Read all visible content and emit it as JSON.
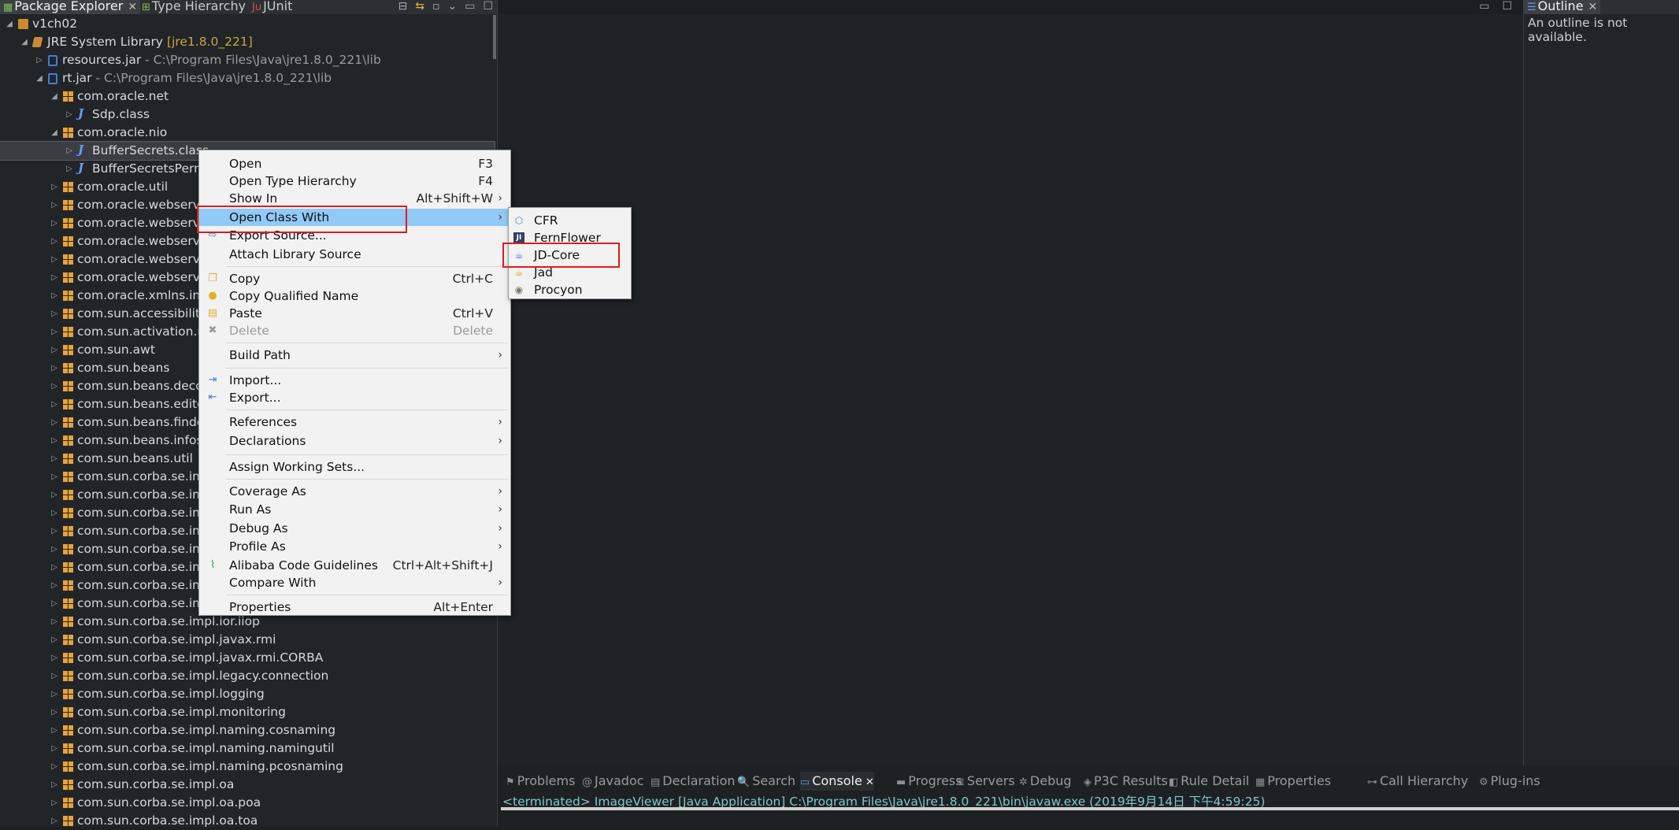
{
  "package_explorer": {
    "tabs": [
      {
        "label": "Package Explorer",
        "icon": "package-explorer-icon",
        "active": true
      },
      {
        "label": "Type Hierarchy",
        "icon": "type-hierarchy-icon",
        "active": false
      },
      {
        "label": "JUnit",
        "icon": "junit-icon",
        "active": false
      }
    ],
    "tree": [
      {
        "depth": 0,
        "twisty": "open",
        "icon": "project",
        "label": "v1ch02"
      },
      {
        "depth": 1,
        "twisty": "open",
        "icon": "lib",
        "label": "JRE System Library",
        "decor": "[jre1.8.0_221]"
      },
      {
        "depth": 2,
        "twisty": "closed",
        "icon": "jar",
        "label": "resources.jar",
        "decor": " - C:\\Program Files\\Java\\jre1.8.0_221\\lib"
      },
      {
        "depth": 2,
        "twisty": "open",
        "icon": "jar",
        "label": "rt.jar",
        "decor": " - C:\\Program Files\\Java\\jre1.8.0_221\\lib"
      },
      {
        "depth": 3,
        "twisty": "open",
        "icon": "pkg",
        "label": "com.oracle.net"
      },
      {
        "depth": 4,
        "twisty": "closed",
        "icon": "cls",
        "label": "Sdp.class"
      },
      {
        "depth": 3,
        "twisty": "open",
        "icon": "pkg",
        "label": "com.oracle.nio"
      },
      {
        "depth": 4,
        "twisty": "closed",
        "icon": "cls",
        "label": "BufferSecrets.class",
        "selected": true
      },
      {
        "depth": 4,
        "twisty": "closed",
        "icon": "cls",
        "label": "BufferSecretsPerm"
      },
      {
        "depth": 3,
        "twisty": "closed",
        "icon": "pkg",
        "label": "com.oracle.util"
      },
      {
        "depth": 3,
        "twisty": "closed",
        "icon": "pkg",
        "label": "com.oracle.webservi"
      },
      {
        "depth": 3,
        "twisty": "closed",
        "icon": "pkg",
        "label": "com.oracle.webservi"
      },
      {
        "depth": 3,
        "twisty": "closed",
        "icon": "pkg",
        "label": "com.oracle.webservi"
      },
      {
        "depth": 3,
        "twisty": "closed",
        "icon": "pkg",
        "label": "com.oracle.webservi"
      },
      {
        "depth": 3,
        "twisty": "closed",
        "icon": "pkg",
        "label": "com.oracle.webservi"
      },
      {
        "depth": 3,
        "twisty": "closed",
        "icon": "pkg",
        "label": "com.oracle.xmlns.int"
      },
      {
        "depth": 3,
        "twisty": "closed",
        "icon": "pkg",
        "label": "com.sun.accessibility"
      },
      {
        "depth": 3,
        "twisty": "closed",
        "icon": "pkg",
        "label": "com.sun.activation.re"
      },
      {
        "depth": 3,
        "twisty": "closed",
        "icon": "pkg",
        "label": "com.sun.awt"
      },
      {
        "depth": 3,
        "twisty": "closed",
        "icon": "pkg",
        "label": "com.sun.beans"
      },
      {
        "depth": 3,
        "twisty": "closed",
        "icon": "pkg",
        "label": "com.sun.beans.deco"
      },
      {
        "depth": 3,
        "twisty": "closed",
        "icon": "pkg",
        "label": "com.sun.beans.edito"
      },
      {
        "depth": 3,
        "twisty": "closed",
        "icon": "pkg",
        "label": "com.sun.beans.finde"
      },
      {
        "depth": 3,
        "twisty": "closed",
        "icon": "pkg",
        "label": "com.sun.beans.infos"
      },
      {
        "depth": 3,
        "twisty": "closed",
        "icon": "pkg",
        "label": "com.sun.beans.util"
      },
      {
        "depth": 3,
        "twisty": "closed",
        "icon": "pkg",
        "label": "com.sun.corba.se.impl"
      },
      {
        "depth": 3,
        "twisty": "closed",
        "icon": "pkg",
        "label": "com.sun.corba.se.imp"
      },
      {
        "depth": 3,
        "twisty": "closed",
        "icon": "pkg",
        "label": "com.sun.corba.se.imp"
      },
      {
        "depth": 3,
        "twisty": "closed",
        "icon": "pkg",
        "label": "com.sun.corba.se.im"
      },
      {
        "depth": 3,
        "twisty": "closed",
        "icon": "pkg",
        "label": "com.sun.corba.se.im"
      },
      {
        "depth": 3,
        "twisty": "closed",
        "icon": "pkg",
        "label": "com.sun.corba.se.im"
      },
      {
        "depth": 3,
        "twisty": "closed",
        "icon": "pkg",
        "label": "com.sun.corba.se.imp"
      },
      {
        "depth": 3,
        "twisty": "closed",
        "icon": "pkg",
        "label": "com.sun.corba.se.imp"
      },
      {
        "depth": 3,
        "twisty": "closed",
        "icon": "pkg",
        "label": "com.sun.corba.se.impl.ior.iiop"
      },
      {
        "depth": 3,
        "twisty": "closed",
        "icon": "pkg",
        "label": "com.sun.corba.se.impl.javax.rmi"
      },
      {
        "depth": 3,
        "twisty": "closed",
        "icon": "pkg",
        "label": "com.sun.corba.se.impl.javax.rmi.CORBA"
      },
      {
        "depth": 3,
        "twisty": "closed",
        "icon": "pkg",
        "label": "com.sun.corba.se.impl.legacy.connection"
      },
      {
        "depth": 3,
        "twisty": "closed",
        "icon": "pkg",
        "label": "com.sun.corba.se.impl.logging"
      },
      {
        "depth": 3,
        "twisty": "closed",
        "icon": "pkg",
        "label": "com.sun.corba.se.impl.monitoring"
      },
      {
        "depth": 3,
        "twisty": "closed",
        "icon": "pkg",
        "label": "com.sun.corba.se.impl.naming.cosnaming"
      },
      {
        "depth": 3,
        "twisty": "closed",
        "icon": "pkg",
        "label": "com.sun.corba.se.impl.naming.namingutil"
      },
      {
        "depth": 3,
        "twisty": "closed",
        "icon": "pkg",
        "label": "com.sun.corba.se.impl.naming.pcosnaming"
      },
      {
        "depth": 3,
        "twisty": "closed",
        "icon": "pkg",
        "label": "com.sun.corba.se.impl.oa"
      },
      {
        "depth": 3,
        "twisty": "closed",
        "icon": "pkg",
        "label": "com.sun.corba.se.impl.oa.poa"
      },
      {
        "depth": 3,
        "twisty": "closed",
        "icon": "pkg",
        "label": "com.sun.corba.se.impl.oa.toa"
      }
    ]
  },
  "outline": {
    "tab_label": "Outline",
    "message": "An outline is not available."
  },
  "context_menu": {
    "items": [
      {
        "label": "Open",
        "shortcut": "F3"
      },
      {
        "label": "Open Type Hierarchy",
        "shortcut": "F4"
      },
      {
        "label": "Show In",
        "shortcut": "Alt+Shift+W",
        "submenu": true
      },
      {
        "label": "Open Class With",
        "submenu": true,
        "highlighted": true
      },
      {
        "label": "Export Source...",
        "icon": "export-source-icon"
      },
      {
        "label": "Attach Library Source"
      },
      {
        "separator": true
      },
      {
        "label": "Copy",
        "shortcut": "Ctrl+C",
        "icon": "copy-icon"
      },
      {
        "label": "Copy Qualified Name",
        "icon": "copy-qualified-name-icon"
      },
      {
        "label": "Paste",
        "shortcut": "Ctrl+V",
        "icon": "paste-icon"
      },
      {
        "label": "Delete",
        "shortcut": "Delete",
        "icon": "delete-icon",
        "disabled": true
      },
      {
        "separator": true
      },
      {
        "label": "Build Path",
        "submenu": true
      },
      {
        "separator": true
      },
      {
        "label": "Import...",
        "icon": "import-icon"
      },
      {
        "label": "Export...",
        "icon": "export-icon"
      },
      {
        "separator": true
      },
      {
        "label": "References",
        "submenu": true
      },
      {
        "label": "Declarations",
        "submenu": true
      },
      {
        "separator": true
      },
      {
        "label": "Assign Working Sets..."
      },
      {
        "separator": true
      },
      {
        "label": "Coverage As",
        "submenu": true
      },
      {
        "label": "Run As",
        "submenu": true
      },
      {
        "label": "Debug As",
        "submenu": true
      },
      {
        "label": "Profile As",
        "submenu": true
      },
      {
        "label": "Alibaba Code Guidelines",
        "shortcut": "Ctrl+Alt+Shift+J",
        "icon": "alibaba-icon"
      },
      {
        "label": "Compare With",
        "submenu": true
      },
      {
        "separator": true
      },
      {
        "label": "Properties",
        "shortcut": "Alt+Enter"
      }
    ]
  },
  "submenu": {
    "items": [
      {
        "label": "CFR",
        "icon": "cfr-icon"
      },
      {
        "label": "FernFlower",
        "icon": "fernflower-icon"
      },
      {
        "label": "JD-Core",
        "icon": "jd-core-icon"
      },
      {
        "label": "Jad",
        "icon": "jad-icon"
      },
      {
        "label": "Procyon",
        "icon": "procyon-icon"
      }
    ]
  },
  "bottom_panel": {
    "tabs": [
      {
        "label": "Problems",
        "icon": "problems-icon"
      },
      {
        "label": "Javadoc",
        "icon": "javadoc-icon"
      },
      {
        "label": "Declaration",
        "icon": "declaration-icon"
      },
      {
        "label": "Search",
        "icon": "search-icon"
      },
      {
        "label": "Console",
        "icon": "console-icon",
        "active": true
      },
      {
        "label": "Progress",
        "icon": "progress-icon"
      },
      {
        "label": "Servers",
        "icon": "servers-icon"
      },
      {
        "label": "Debug",
        "icon": "debug-icon"
      },
      {
        "label": "P3C Results",
        "icon": "p3c-results-icon"
      },
      {
        "label": "Rule Detail",
        "icon": "rule-detail-icon"
      },
      {
        "label": "Properties",
        "icon": "properties-icon"
      },
      {
        "label": "Call Hierarchy",
        "icon": "call-hierarchy-icon"
      },
      {
        "label": "Plug-ins",
        "icon": "plug-ins-icon"
      }
    ],
    "console_text": "<terminated> ImageViewer [Java Application] C:\\Program Files\\Java\\jre1.8.0_221\\bin\\javaw.exe (2019年9月14日 下午4:59:25)"
  }
}
